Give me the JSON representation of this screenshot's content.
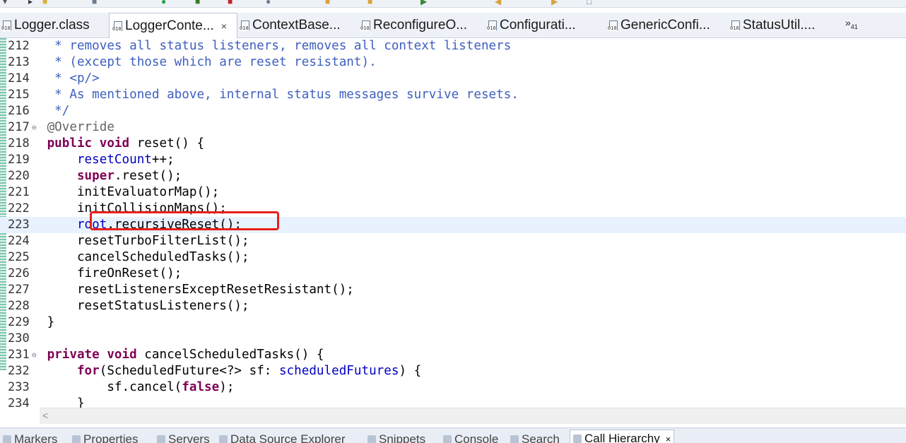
{
  "tabs": [
    {
      "label": "Logger.class",
      "active": false
    },
    {
      "label": "LoggerConte...",
      "active": true
    },
    {
      "label": "ContextBase...",
      "active": false
    },
    {
      "label": "ReconfigureO...",
      "active": false
    },
    {
      "label": "Configurati...",
      "active": false
    },
    {
      "label": "GenericConfi...",
      "active": false
    },
    {
      "label": "StatusUtil....",
      "active": false
    }
  ],
  "tab_close_glyph": "×",
  "tab_overflow": "»",
  "tab_overflow_count": "41",
  "icon_bits": "010",
  "editor": {
    "highlighted_line": "223",
    "lines": [
      {
        "n": "212",
        "code": "  * removes all status listeners, removes all context listeners"
      },
      {
        "n": "213",
        "code": "  * (except those which are reset resistant)."
      },
      {
        "n": "214",
        "code": "  * <p/>"
      },
      {
        "n": "215",
        "code": "  * As mentioned above, internal status messages survive resets."
      },
      {
        "n": "216",
        "code": "  */"
      },
      {
        "n": "217",
        "code": " @Override",
        "fold": "⊖"
      },
      {
        "n": "218",
        "code": " public void reset() {"
      },
      {
        "n": "219",
        "code": "     resetCount++;"
      },
      {
        "n": "220",
        "code": "     super.reset();"
      },
      {
        "n": "221",
        "code": "     initEvaluatorMap();"
      },
      {
        "n": "222",
        "code": "     initCollisionMaps();"
      },
      {
        "n": "223",
        "code": "     root.recursiveReset();"
      },
      {
        "n": "224",
        "code": "     resetTurboFilterList();"
      },
      {
        "n": "225",
        "code": "     cancelScheduledTasks();"
      },
      {
        "n": "226",
        "code": "     fireOnReset();"
      },
      {
        "n": "227",
        "code": "     resetListenersExceptResetResistant();"
      },
      {
        "n": "228",
        "code": "     resetStatusListeners();"
      },
      {
        "n": "229",
        "code": " }"
      },
      {
        "n": "230",
        "code": ""
      },
      {
        "n": "231",
        "code": " private void cancelScheduledTasks() {",
        "fold": "⊖"
      },
      {
        "n": "232",
        "code": "     for(ScheduledFuture<?> sf: scheduledFutures) {"
      },
      {
        "n": "233",
        "code": "         sf.cancel(false);"
      },
      {
        "n": "234",
        "code": "     }"
      }
    ]
  },
  "scroll_left_glyph": "<",
  "bottom_tabs": [
    {
      "label": "Markers",
      "active": false
    },
    {
      "label": "Properties",
      "active": false
    },
    {
      "label": "Servers",
      "active": false
    },
    {
      "label": "Data Source Explorer",
      "active": false
    },
    {
      "label": "Snippets",
      "active": false
    },
    {
      "label": "Console",
      "active": false
    },
    {
      "label": "Search",
      "active": false
    },
    {
      "label": "Call Hierarchy",
      "active": true
    }
  ],
  "colors": {
    "comment": "#3f5fbf",
    "keyword": "#7f0055",
    "field": "#0000c0",
    "highlight_box": "#e8201a",
    "current_line": "#e8f2fe"
  }
}
